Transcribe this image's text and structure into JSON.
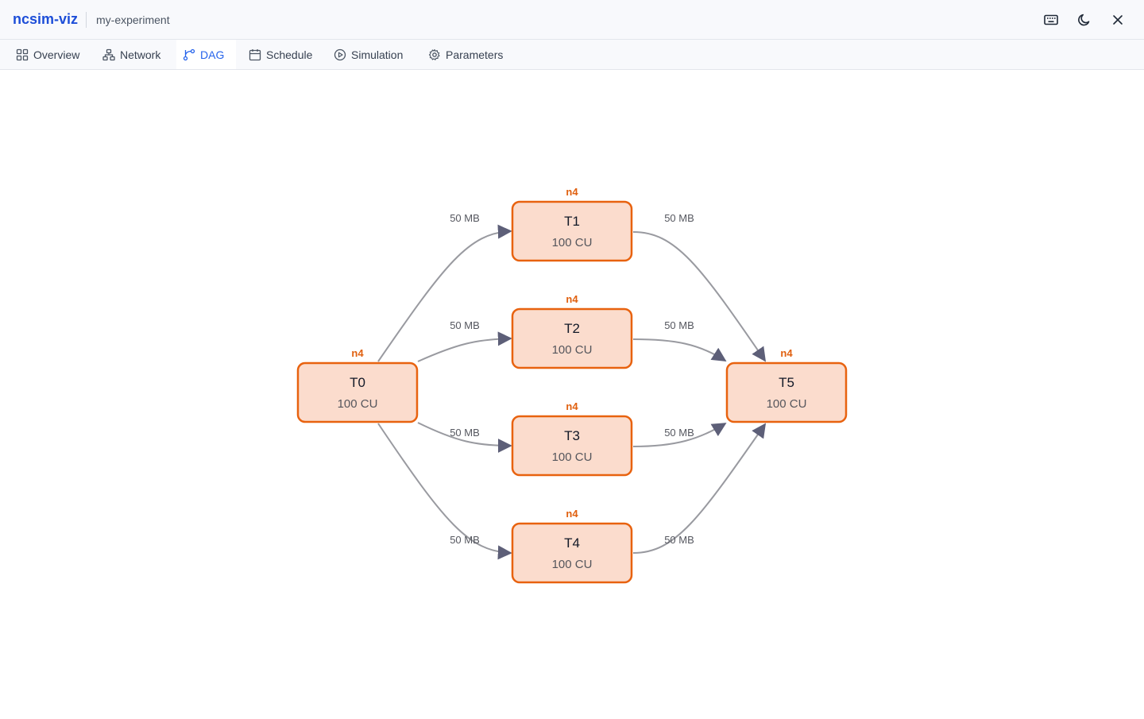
{
  "app": {
    "brand": "ncsim-viz",
    "project": "my-experiment"
  },
  "toolbar": {
    "icons": [
      "keyboard-icon",
      "moon-icon",
      "close-icon"
    ]
  },
  "tabs": [
    {
      "label": "Overview",
      "icon": "grid-icon",
      "active": false
    },
    {
      "label": "Network",
      "icon": "network-icon",
      "active": false
    },
    {
      "label": "DAG",
      "icon": "branch-icon",
      "active": true
    },
    {
      "label": "Schedule",
      "icon": "calendar-icon",
      "active": false
    },
    {
      "label": "Simulation",
      "icon": "play-circle-icon",
      "active": false
    },
    {
      "label": "Parameters",
      "icon": "gear-icon",
      "active": false
    }
  ],
  "dag": {
    "colors": {
      "node_fill": "#fbdccd",
      "node_stroke": "#e8620f",
      "host_label": "#e0600f",
      "edge": "#999aa0"
    },
    "nodes": [
      {
        "id": "T0",
        "cost": "100 CU",
        "host": "n4"
      },
      {
        "id": "T1",
        "cost": "100 CU",
        "host": "n4"
      },
      {
        "id": "T2",
        "cost": "100 CU",
        "host": "n4"
      },
      {
        "id": "T3",
        "cost": "100 CU",
        "host": "n4"
      },
      {
        "id": "T4",
        "cost": "100 CU",
        "host": "n4"
      },
      {
        "id": "T5",
        "cost": "100 CU",
        "host": "n4"
      }
    ],
    "edges": [
      {
        "from": "T0",
        "to": "T1",
        "label": "50 MB"
      },
      {
        "from": "T0",
        "to": "T2",
        "label": "50 MB"
      },
      {
        "from": "T0",
        "to": "T3",
        "label": "50 MB"
      },
      {
        "from": "T0",
        "to": "T4",
        "label": "50 MB"
      },
      {
        "from": "T1",
        "to": "T5",
        "label": "50 MB"
      },
      {
        "from": "T2",
        "to": "T5",
        "label": "50 MB"
      },
      {
        "from": "T3",
        "to": "T5",
        "label": "50 MB"
      },
      {
        "from": "T4",
        "to": "T5",
        "label": "50 MB"
      }
    ]
  }
}
